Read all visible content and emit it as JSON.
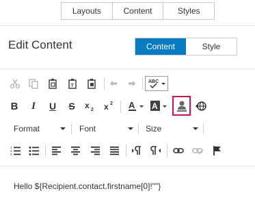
{
  "top_tabs": [
    "Layouts",
    "Content",
    "Styles"
  ],
  "header": {
    "title": "Edit Content"
  },
  "mode_toggle": {
    "content_label": "Content",
    "style_label": "Style",
    "active": "Content"
  },
  "toolbar": {
    "dropdowns": {
      "format": "Format",
      "font": "Font",
      "size": "Size"
    },
    "spell_label": "ABC"
  },
  "editor": {
    "text": "Hello ${Recipient.contact.firstname[0]!\"\"}"
  },
  "colors": {
    "accent": "#0a7bc1",
    "highlight": "#d0104c"
  }
}
